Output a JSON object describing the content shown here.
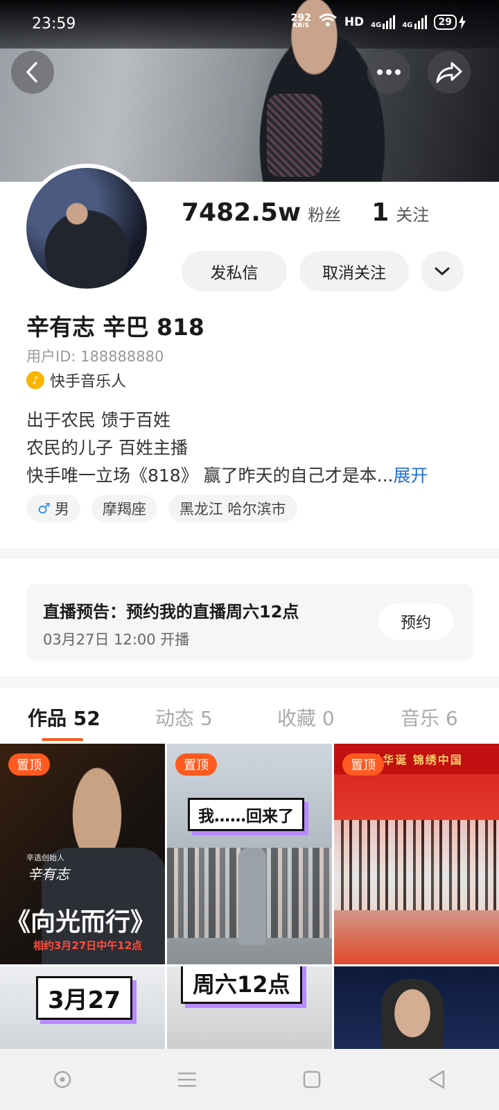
{
  "status_bar": {
    "time": "23:59",
    "net_speed": "292",
    "net_unit": "KB/S",
    "hd": "HD",
    "signal1": "4G",
    "signal2": "4G",
    "battery": "29"
  },
  "profile": {
    "followers_count": "7482.5w",
    "followers_label": "粉丝",
    "following_count": "1",
    "following_label": "关注",
    "message_button": "发私信",
    "unfollow_button": "取消关注",
    "name": "辛有志 辛巴 818",
    "user_id": "用户ID: 188888880",
    "badge": "快手音乐人",
    "bio_lines": [
      "出于农民 馈于百姓",
      "农民的儿子  百姓主播",
      "快手唯一立场《818》 赢了昨天的自己才是本..."
    ],
    "bio_expand": "展开",
    "tags": {
      "gender_symbol": "♂",
      "gender": "男",
      "zodiac": "摩羯座",
      "location": "黑龙江 哈尔滨市"
    }
  },
  "live_notice": {
    "title": "直播预告：预约我的直播周六12点",
    "time": "03月27日 12:00 开播",
    "reserve_button": "预约"
  },
  "tabs": [
    {
      "label": "作品 52"
    },
    {
      "label": "动态 5"
    },
    {
      "label": "收藏 0"
    },
    {
      "label": "音乐 6"
    }
  ],
  "grid": {
    "pin_label": "置顶",
    "c1_small": "辛选创始人",
    "c1_sign": "辛有志",
    "c1_big": "《向光而行》",
    "c1_date": "相约3月27日中午12点",
    "c2_caption": "我……回来了",
    "c3_banner": "世华诞  锦绣中国",
    "c4_caption": "3月27",
    "c5_caption": "周六12点"
  },
  "colors": {
    "accent": "#ff5a1f",
    "link": "#1f6fd0"
  }
}
